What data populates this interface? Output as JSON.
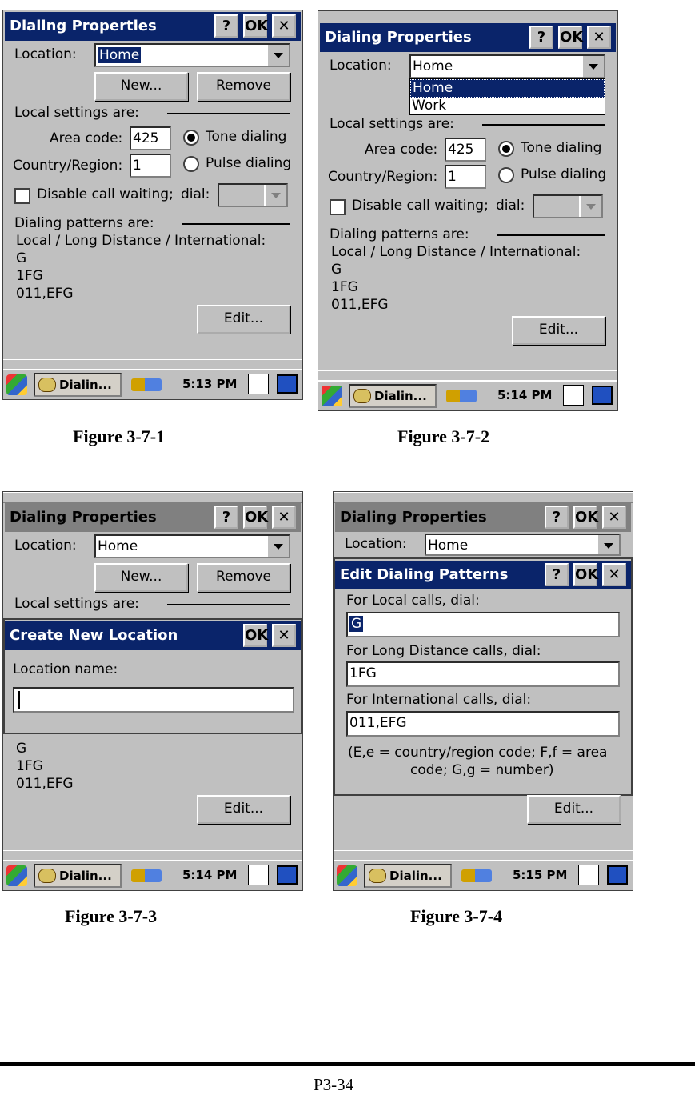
{
  "window_title": "Dialing Properties",
  "buttons": {
    "help": "?",
    "ok": "OK",
    "close": "✕",
    "new": "New...",
    "remove": "Remove",
    "edit": "Edit..."
  },
  "labels": {
    "location": "Location:",
    "local_settings": "Local settings are:",
    "area_code": "Area code:",
    "country_region": "Country/Region:",
    "tone_dialing": "Tone dialing",
    "pulse_dialing": "Pulse dialing",
    "disable_call_waiting": "Disable call waiting;",
    "dial": "dial:",
    "dialing_patterns": "Dialing patterns are:",
    "pattern_header": "Local / Long Distance / International:",
    "pattern_local": "G",
    "pattern_long": "1FG",
    "pattern_intl": "011,EFG"
  },
  "values": {
    "location": "Home",
    "area_code": "425",
    "country_code": "1"
  },
  "location_options": [
    "Home",
    "Work"
  ],
  "create_location": {
    "title": "Create New Location",
    "name_label": "Location name:",
    "name_value": ""
  },
  "edit_patterns": {
    "title": "Edit Dialing Patterns",
    "local_label": "For Local calls, dial:",
    "local_value": "G",
    "long_label": "For Long Distance calls, dial:",
    "long_value": "1FG",
    "intl_label": "For International calls, dial:",
    "intl_value": "011,EFG",
    "note_line1": "(E,e = country/region code; F,f = area",
    "note_line2": "code; G,g = number)"
  },
  "taskbar": {
    "task_label": "Dialin...",
    "times": [
      "5:13 PM",
      "5:14 PM",
      "5:14 PM",
      "5:15 PM"
    ]
  },
  "captions": [
    "Figure 3-7-1",
    "Figure 3-7-2",
    "Figure 3-7-3",
    "Figure 3-7-4"
  ],
  "page_number": "P3-34",
  "colors": {
    "titlebar_active": "#0a246a",
    "titlebar_inactive": "#808080",
    "face": "#c0c0c0"
  }
}
